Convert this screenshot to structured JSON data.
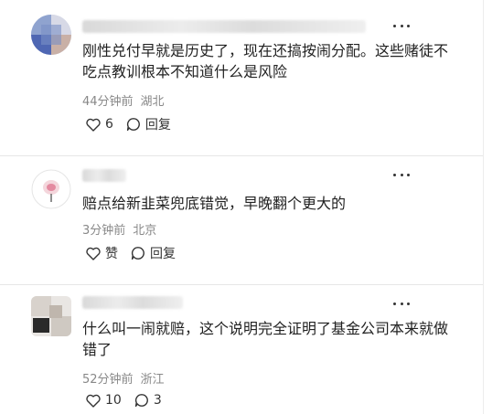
{
  "comments": [
    {
      "text": "刚性兑付早就是历史了，现在还搞按闹分配。这些赌徒不吃点教训根本不知道什么是风险",
      "time": "44分钟前",
      "location": "湖北",
      "like_label": "6",
      "reply_label": "回复"
    },
    {
      "text": "赔点给新韭菜兜底错觉，早晚翻个更大的",
      "time": "3分钟前",
      "location": "北京",
      "like_label": "赞",
      "reply_label": "回复"
    },
    {
      "text": "什么叫一闹就赔，这个说明完全证明了基金公司本来就做错了",
      "time": "52分钟前",
      "location": "浙江",
      "like_label": "10",
      "reply_label": "3"
    }
  ],
  "icons": {
    "like": "heart-outline-icon",
    "reply": "speech-bubble-icon",
    "more": "more-dots-icon"
  },
  "colors": {
    "meta_text": "#888888",
    "body_text": "#222222",
    "divider": "#e6e6e6"
  }
}
